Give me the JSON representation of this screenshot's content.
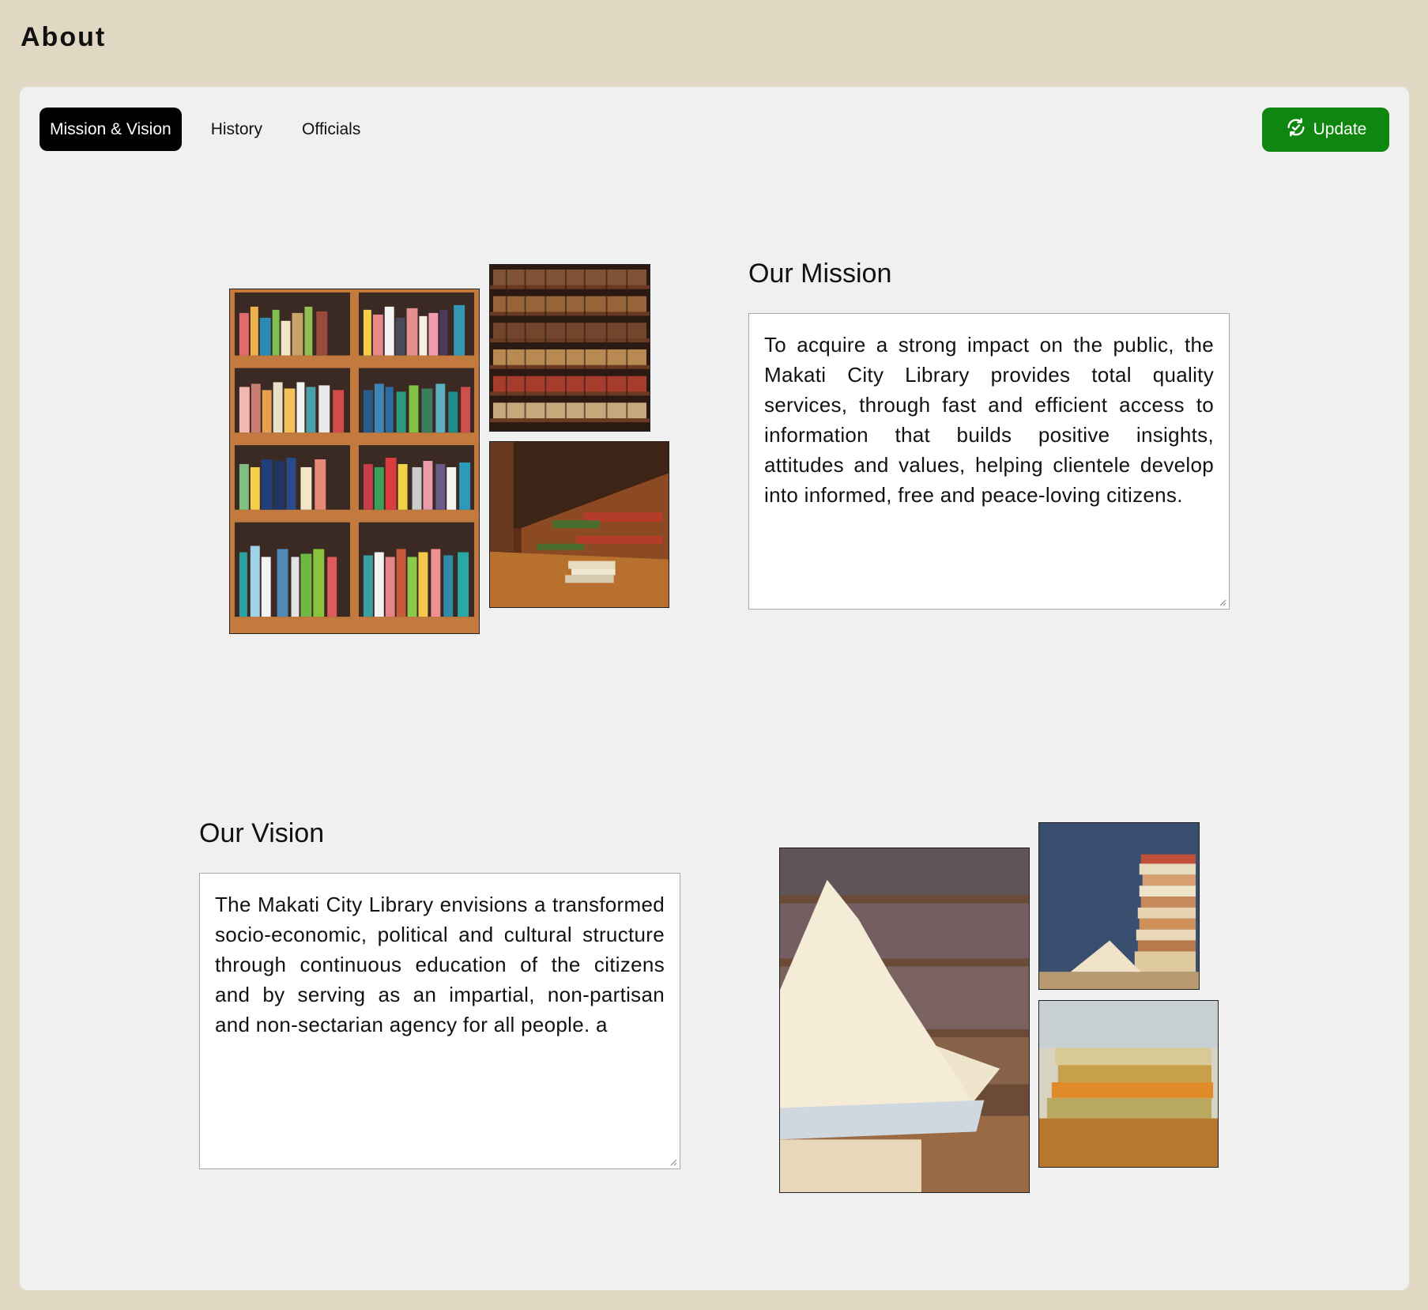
{
  "header": {
    "title": "About"
  },
  "tabs": [
    {
      "label": "Mission & Vision",
      "active": true
    },
    {
      "label": "History",
      "active": false
    },
    {
      "label": "Officials",
      "active": false
    }
  ],
  "actions": {
    "update_label": "Update",
    "update_icon": "refresh-check-icon",
    "update_color": "#0f860f"
  },
  "mission": {
    "title": "Our Mission",
    "text": "To acquire a strong impact on the public, the Makati City Library provides total quality services, through fast and efficient access to information that builds positive insights, attitudes and values, helping clientele develop into informed, free and peace-loving citizens."
  },
  "vision": {
    "title": "Our Vision",
    "text": "The Makati City Library envisions a transformed socio-economic, political and cultural structure through continuous education of the citizens and by serving as an impartial, non-partisan and non-sectarian agency for all people. a"
  },
  "colors": {
    "background": "#e0d8c2",
    "panel": "#f0f0f0",
    "active_tab": "#000000"
  }
}
